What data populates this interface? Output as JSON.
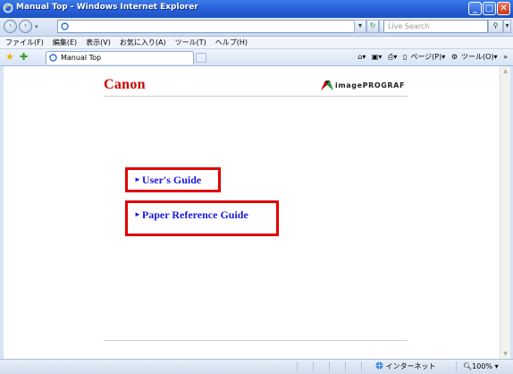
{
  "window": {
    "title": "Manual Top - Windows Internet Explorer",
    "buttons": [
      "minimize-icon",
      "maximize-icon",
      "close-icon"
    ]
  },
  "address_bar": {
    "url": "",
    "search_placeholder": "Live Search"
  },
  "menu": {
    "items": [
      "ファイル(F)",
      "編集(E)",
      "表示(V)",
      "お気に入り(A)",
      "ツール(T)",
      "ヘルプ(H)"
    ]
  },
  "tabs": [
    {
      "label": "Manual Top",
      "active": true
    }
  ],
  "command_bar": {
    "page_label": "ページ(P)",
    "tools_label": "ツール(O)"
  },
  "page": {
    "brand": "Canon",
    "product": "imagePROGRAF",
    "links": [
      {
        "label": "User's Guide"
      },
      {
        "label": "Paper Reference Guide"
      }
    ],
    "colors": {
      "brand": "#cc0000",
      "link": "#1b1be0",
      "highlight_border": "#e00000"
    }
  },
  "status_bar": {
    "zone": "インターネット",
    "zoom": "100%"
  }
}
